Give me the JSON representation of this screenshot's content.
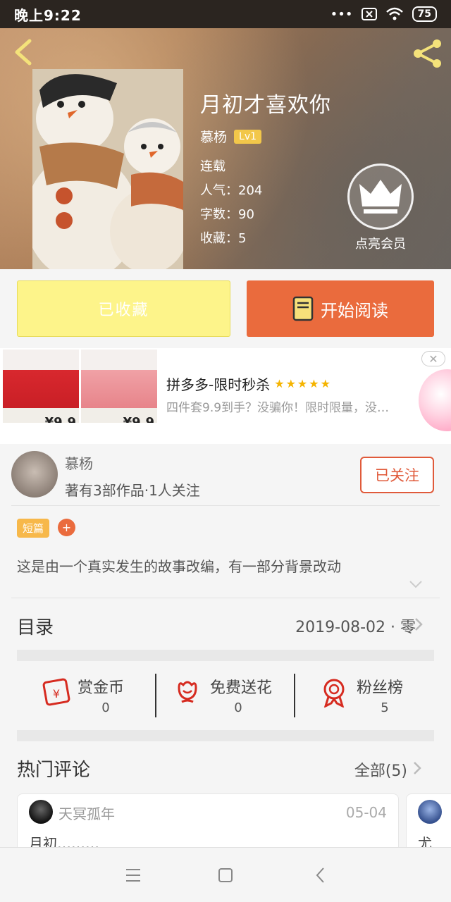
{
  "status_bar": {
    "time": "晚上9:22",
    "battery": "75"
  },
  "book": {
    "title": "月初才喜欢你",
    "author": "慕杨",
    "author_level": "Lv1",
    "status": "连载",
    "popularity": "人气：204",
    "word_count": "字数：90",
    "favorites": "收藏：5",
    "vip_label": "点亮会员"
  },
  "actions": {
    "favorited_label": "已收藏",
    "read_label": "开始阅读"
  },
  "ad": {
    "title": "拼多多-限时秒杀",
    "stars": "★★★★★",
    "description": "四件套9.9到手？没骗你！限时限量，没…",
    "price1": "¥9.9",
    "price2": "¥9.9",
    "close": "✕"
  },
  "author_info": {
    "name": "慕杨",
    "stats": "著有3部作品·1人关注",
    "follow_label": "已关注"
  },
  "tags": {
    "category": "短篇",
    "add": "+"
  },
  "intro": "这是由一个真实发生的故事改编，有一部分背景改动",
  "toc": {
    "label": "目录",
    "latest": "2019-08-02 · 零"
  },
  "stats": [
    {
      "label": "赏金币",
      "value": "0",
      "icon": "red-envelope-icon"
    },
    {
      "label": "免费送花",
      "value": "0",
      "icon": "flower-icon"
    },
    {
      "label": "粉丝榜",
      "value": "5",
      "icon": "medal-icon"
    }
  ],
  "comments_section": {
    "label": "热门评论",
    "all_label": "全部(5)"
  },
  "comments": [
    {
      "user": "天冥孤年",
      "date": "05-04",
      "text": "月初………"
    },
    {
      "user": "",
      "date": "",
      "text": "尤"
    }
  ],
  "colors": {
    "accent": "#ea6b3d",
    "favorite_bg": "#fdf48a",
    "level_badge": "#f2c74a",
    "star": "#f5b400"
  }
}
